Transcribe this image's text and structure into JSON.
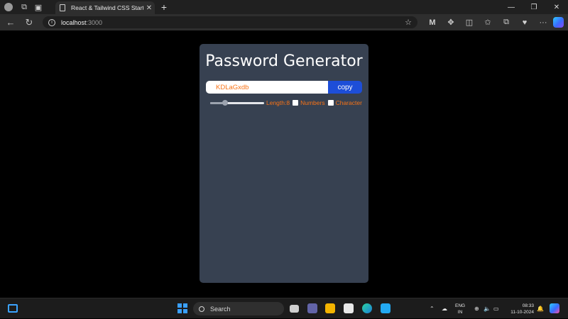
{
  "browser": {
    "tab_title": "React & Tailwind CSS Starter Pack",
    "url_host": "localhost",
    "url_port": ":3000"
  },
  "app": {
    "title": "Password Generator",
    "password": "KDLaGxdb",
    "copy_label": "copy",
    "length_label": "Length:8",
    "length_value": 8,
    "length_fraction": 0.28,
    "numbers_label": "Numbers",
    "numbers_checked": false,
    "character_label": "Character",
    "character_checked": false
  },
  "taskbar": {
    "search_label": "Search",
    "lang_line1": "ENG",
    "lang_line2": "IN",
    "time": "08:33",
    "date": "11-10-2024"
  },
  "colors": {
    "card_bg": "#374151",
    "accent_text": "#f97316",
    "copy_button": "#1d4ed8"
  }
}
